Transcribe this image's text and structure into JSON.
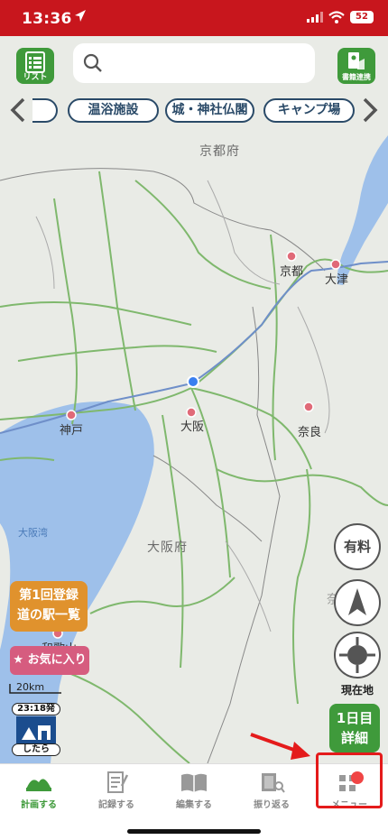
{
  "status": {
    "time": "13:36",
    "battery": "52"
  },
  "header": {
    "list_label": "リスト",
    "search_placeholder": "",
    "book_label": "書籍連携"
  },
  "chips": [
    "温浴施設",
    "城・神社仏閣",
    "キャンプ場"
  ],
  "map": {
    "prefectures": [
      "京都府",
      "大阪府",
      "奈良県"
    ],
    "cities": [
      "京都",
      "大津",
      "神戸",
      "大阪",
      "奈良",
      "和歌山"
    ],
    "bay": "大阪湾",
    "scale": "20km"
  },
  "controls": {
    "paid_label": "有料",
    "locate_label": "現在地",
    "day_label_1": "1日目",
    "day_label_2": "詳細",
    "station_label_1": "第1回登録",
    "station_label_2": "道の駅一覧",
    "favorite_label": "お気に入り",
    "depart_time": "23:18発",
    "depart_sub": "したら"
  },
  "tabs": [
    {
      "label": "計画する",
      "icon": "plan-icon"
    },
    {
      "label": "記録する",
      "icon": "record-icon"
    },
    {
      "label": "編集する",
      "icon": "edit-book-icon"
    },
    {
      "label": "振り返る",
      "icon": "review-icon"
    },
    {
      "label": "メニュー",
      "icon": "menu-grid-icon"
    }
  ],
  "colors": {
    "brand_red": "#c8161d",
    "brand_green": "#3f9a3b",
    "highlight": "#e41b1b"
  }
}
